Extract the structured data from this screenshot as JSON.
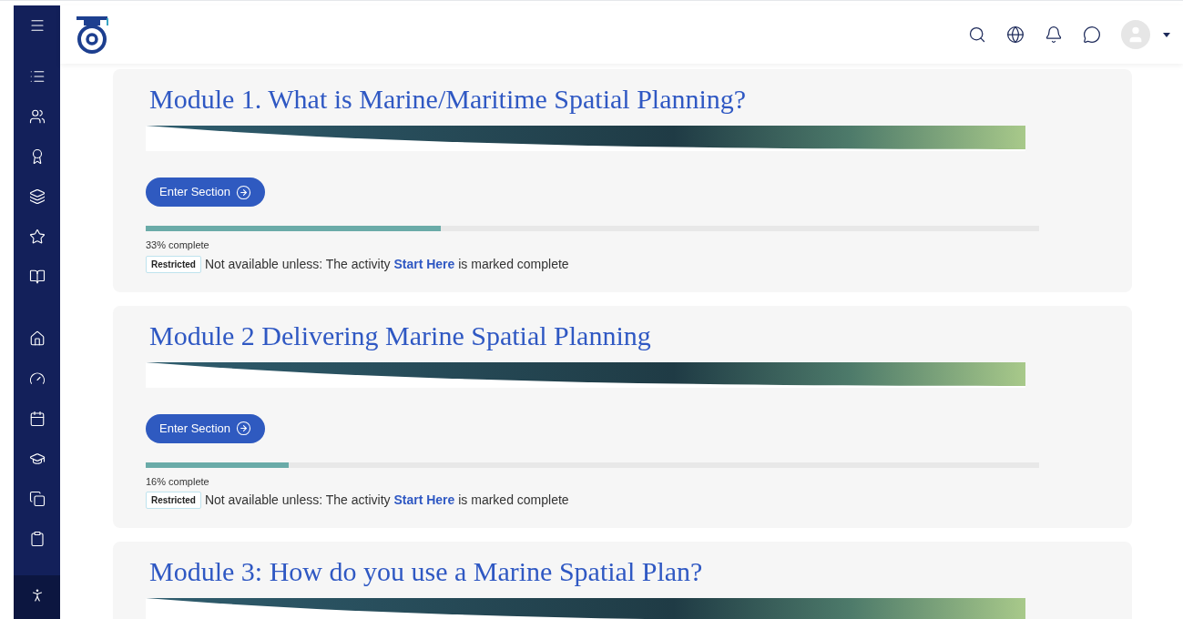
{
  "modules": [
    {
      "title": "Module 1. What is Marine/Maritime Spatial Planning?",
      "button": "Enter Section",
      "level": 0.33,
      "progress_label": "33% complete",
      "badge": "Restricted",
      "restriction": {
        "prefix": "Not available unless: The activity",
        "link": "Start Here",
        "suffix": "is marked complete"
      }
    },
    {
      "title": "Module 2 Delivering Marine Spatial Planning",
      "button": "Enter Section",
      "level": 0.16,
      "progress_label": "16% complete",
      "badge": "Restricted",
      "restriction": {
        "prefix": "Not available unless: The activity",
        "link": "Start Here",
        "suffix": "is marked complete"
      }
    },
    {
      "title": "Module 3: How do you use a Marine Spatial Plan?"
    }
  ]
}
